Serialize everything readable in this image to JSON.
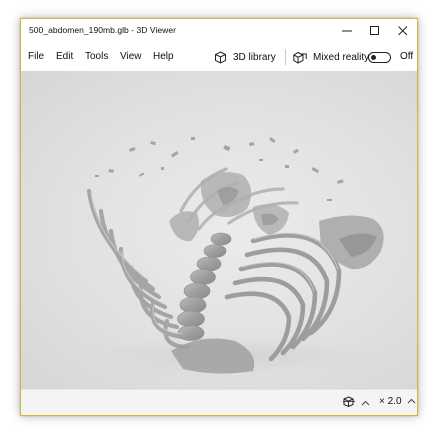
{
  "window": {
    "title": "500_abdomen_190mb.glb - 3D Viewer",
    "border_color": "#d8b23a"
  },
  "menu": {
    "items": [
      {
        "label": "File"
      },
      {
        "label": "Edit"
      },
      {
        "label": "Tools"
      },
      {
        "label": "View"
      },
      {
        "label": "Help"
      }
    ]
  },
  "toolbar": {
    "library_label": "3D library",
    "library_icon": "cube-library-icon",
    "mixed_reality_label": "Mixed reality",
    "mixed_reality_icon": "mixed-reality-icon",
    "mixed_reality_state": "Off"
  },
  "viewport": {
    "model": "abdomen skeleton 3D model",
    "background": "#e3e3e3",
    "model_color": "#9c9c9c"
  },
  "statusbar": {
    "view_icon": "cube-view-icon",
    "zoom_label": "× 2.0"
  }
}
